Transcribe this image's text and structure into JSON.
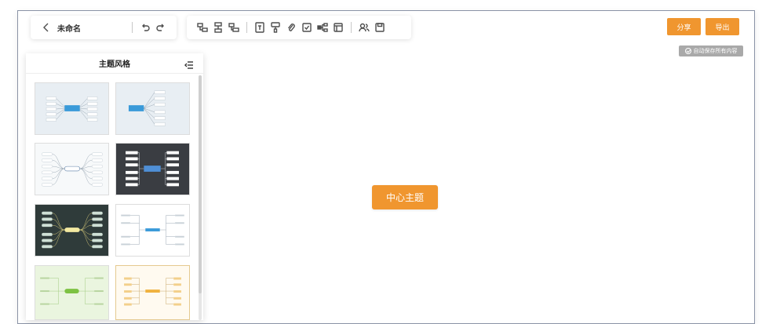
{
  "document": {
    "title": "未命名"
  },
  "header": {
    "share_label": "分享",
    "export_label": "导出",
    "autosave_text": "自动保存所有内容"
  },
  "theme_panel": {
    "title": "主题风格"
  },
  "canvas": {
    "center_node": "中心主题"
  },
  "colors": {
    "accent": "#f0962f",
    "autosave_bg": "#a9a9a9"
  },
  "toolbar_icons": [
    "undo-icon",
    "redo-icon",
    "sibling-node-icon",
    "child-node-icon",
    "parent-node-icon",
    "text-icon",
    "format-brush-icon",
    "attachment-icon",
    "task-icon",
    "relation-icon",
    "summary-icon",
    "collaborate-icon",
    "save-icon"
  ]
}
